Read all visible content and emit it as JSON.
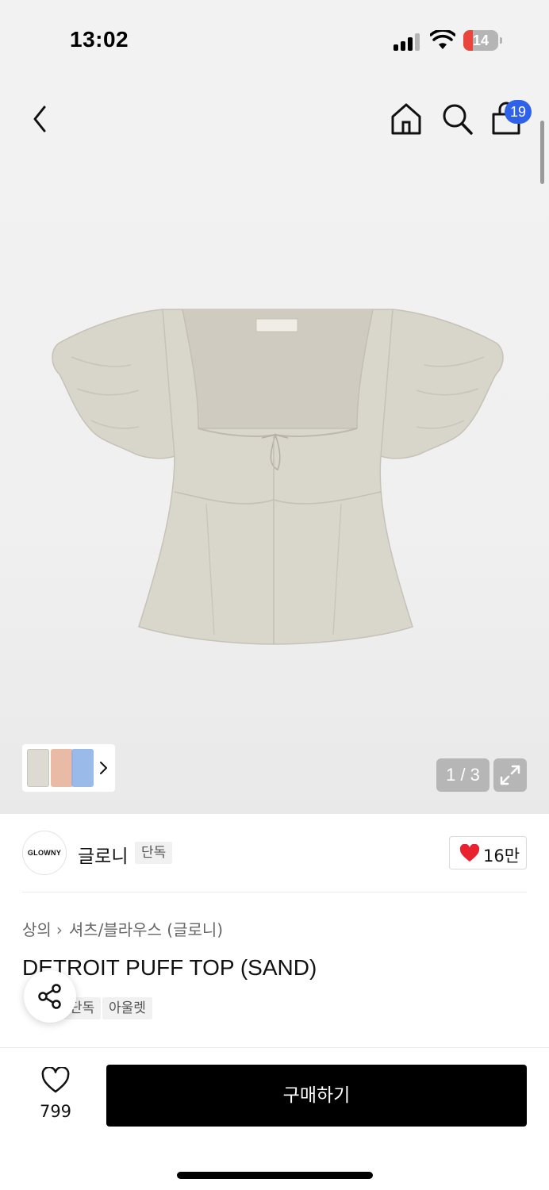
{
  "status_bar": {
    "time": "13:02",
    "battery": "14"
  },
  "header": {
    "cart_count": "19"
  },
  "gallery": {
    "counter": "1 / 3"
  },
  "brand": {
    "logo_text": "GLOWNY",
    "name": "글로니",
    "badge": "단독",
    "likes": "16만"
  },
  "breadcrumb": {
    "category": "상의",
    "subcategory": "셔츠/블라우스 (글로니)"
  },
  "product": {
    "title": "DETROIT PUFF TOP (SAND)",
    "tags": [
      "단독",
      "아울렛"
    ]
  },
  "bottom_bar": {
    "wish_count": "799",
    "buy_label": "구매하기"
  },
  "colors": {
    "accent_blue": "#2f62e9",
    "heart_red": "#e8232f",
    "buy_button": "#000000",
    "product_sand": "#d8d5cb"
  },
  "icons": [
    "back-icon",
    "home-icon",
    "search-icon",
    "shopping-bag-icon",
    "chevron-right-icon",
    "expand-icon",
    "heart-icon",
    "share-icon"
  ]
}
